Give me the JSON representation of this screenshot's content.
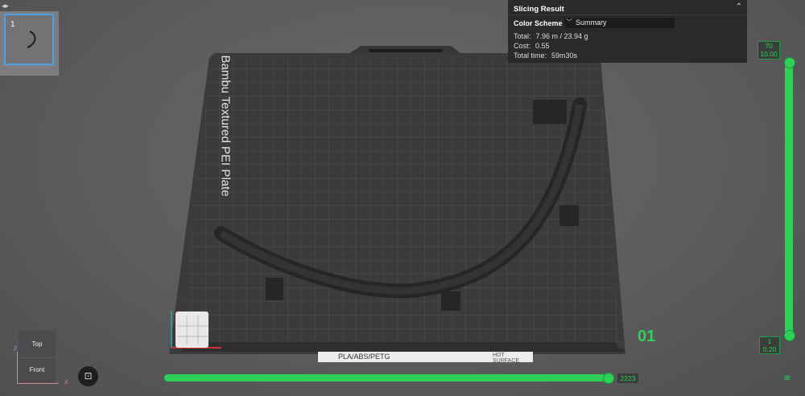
{
  "plate": {
    "thumbnail_number": "1",
    "bed_label": "Bambu Textured PEI Plate",
    "plate_index": "01",
    "strip_material": "PLA/ABS/PETG",
    "strip_hot_surface": "HOT SURFACE"
  },
  "slicing_result": {
    "title": "Slicing Result",
    "color_scheme_label": "Color Scheme",
    "color_scheme_value": "Summary",
    "stats": [
      {
        "label": "Total:",
        "value": "7.96 m / 23.94 g"
      },
      {
        "label": "Cost:",
        "value": "0.55"
      },
      {
        "label": "Total time:",
        "value": "59m30s"
      }
    ]
  },
  "layer_slider": {
    "top_layer": "70",
    "top_height": "10.00",
    "bottom_layer": "1",
    "bottom_height": "0.20"
  },
  "move_slider": {
    "value": "2223"
  },
  "view_cube": {
    "top_label": "Top",
    "front_label": "Front",
    "axis_z": "Z",
    "axis_x": "X"
  },
  "colors": {
    "accent": "#2fd058",
    "panel_bg": "#2a2a2c",
    "bed": "#3a3a3c",
    "part": "#2b2b2b"
  },
  "icons": [
    "sidebar-toggle-icon",
    "collapse-panel-icon",
    "chevron-down-icon",
    "fit-view-icon",
    "layers-icon"
  ]
}
